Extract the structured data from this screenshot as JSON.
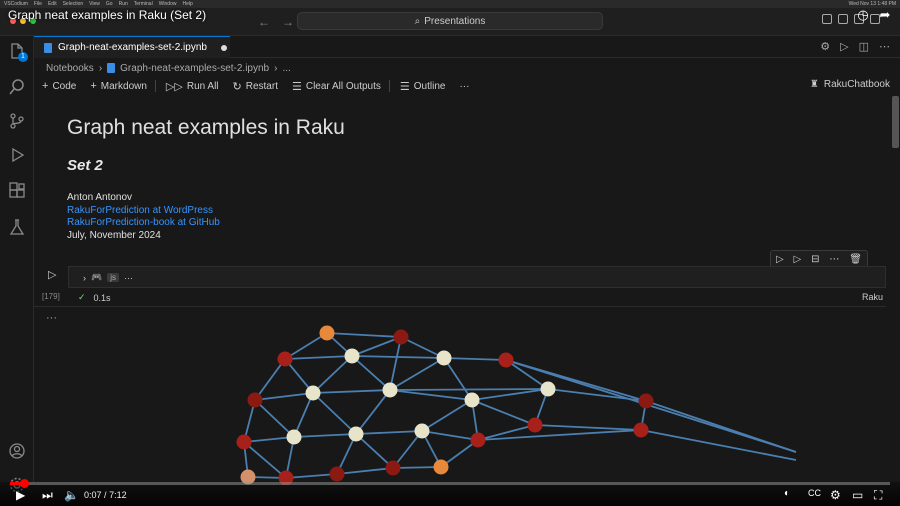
{
  "video": {
    "title": "Graph neat examples in Raku (Set 2)",
    "time_current": "0:07",
    "time_total": "7:12",
    "time_separator": "/",
    "progress_fraction": 0.0162
  },
  "mac_menu": {
    "items": [
      "VSCodium",
      "File",
      "Edit",
      "Selection",
      "View",
      "Go",
      "Run",
      "Terminal",
      "Window",
      "Help"
    ],
    "clock": "Wed Nov 13 1:48 PM"
  },
  "command_center": {
    "label": "Presentations"
  },
  "activity": {
    "explorer_badge": "1"
  },
  "tab": {
    "filename": "Graph-neat-examples-set-2.ipynb"
  },
  "breadcrumb": {
    "root": "Notebooks",
    "file": "Graph-neat-examples-set-2.ipynb",
    "more": "..."
  },
  "toolbar": {
    "code": "Code",
    "markdown": "Markdown",
    "run_all": "Run All",
    "restart": "Restart",
    "clear_outputs": "Clear All Outputs",
    "outline": "Outline",
    "more": "···",
    "kernel": "RakuChatbook"
  },
  "markdown": {
    "title": "Graph neat examples in Raku",
    "subtitle": "Set 2",
    "author": "Anton Antonov",
    "link1": "RakuForPrediction at WordPress",
    "link2": "RakuForPrediction-book at GitHub",
    "date": "July, November 2024"
  },
  "code_cell": {
    "execution_count": "[179]",
    "collapsed_label": "js",
    "collapsed_more": "···",
    "duration": "0.1s",
    "language": "Raku"
  },
  "output": {
    "ellipsis": "···"
  },
  "colors": {
    "edge": "#4a7fb0",
    "node_dark_red": "#8b1a12",
    "node_red": "#a8201a",
    "node_cream": "#e8e4c9",
    "node_orange": "#e8883a",
    "node_peach": "#d4906a",
    "link": "#3794ff",
    "accent": "#0078d4"
  }
}
